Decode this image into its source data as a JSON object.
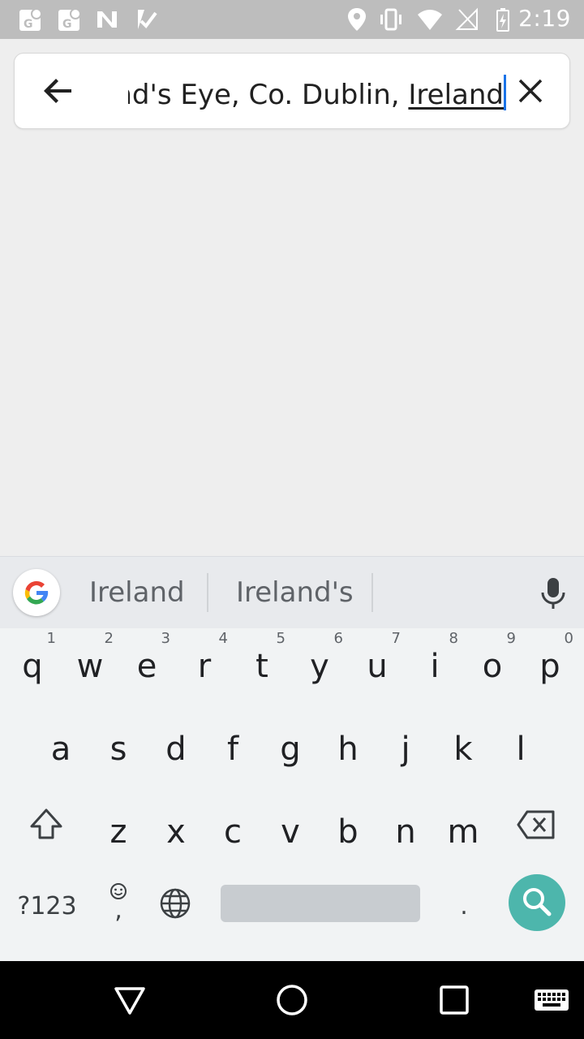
{
  "status_bar": {
    "time": "2:19",
    "left_icons": [
      "maps-notification-icon",
      "maps-notification-icon",
      "n-app-icon",
      "check-notification-icon"
    ],
    "right_icons": [
      "location-icon",
      "vibrate-icon",
      "wifi-icon",
      "no-sim-icon",
      "battery-charging-icon"
    ]
  },
  "search": {
    "query_prefix": "ınd's Eye, Co. Dublin, ",
    "query_last_word": "Ireland",
    "back_icon": "arrow-back-icon",
    "clear_icon": "close-icon"
  },
  "keyboard": {
    "suggestions": [
      "Ireland",
      "Ireland's"
    ],
    "row1": [
      {
        "ch": "q",
        "num": "1"
      },
      {
        "ch": "w",
        "num": "2"
      },
      {
        "ch": "e",
        "num": "3"
      },
      {
        "ch": "r",
        "num": "4"
      },
      {
        "ch": "t",
        "num": "5"
      },
      {
        "ch": "y",
        "num": "6"
      },
      {
        "ch": "u",
        "num": "7"
      },
      {
        "ch": "i",
        "num": "8"
      },
      {
        "ch": "o",
        "num": "9"
      },
      {
        "ch": "p",
        "num": "0"
      }
    ],
    "row2": [
      "a",
      "s",
      "d",
      "f",
      "g",
      "h",
      "j",
      "k",
      "l"
    ],
    "row3": [
      "z",
      "x",
      "c",
      "v",
      "b",
      "n",
      "m"
    ],
    "symbols_label": "?123",
    "emoji_comma": ",",
    "period": "."
  },
  "colors": {
    "accent_blue": "#1a73e8",
    "search_key": "#4db6ac",
    "status_bar": "#bdbdbd"
  }
}
